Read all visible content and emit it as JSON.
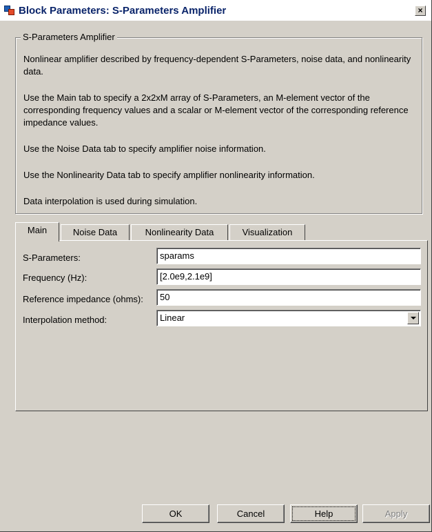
{
  "window": {
    "title": "Block Parameters: S-Parameters Amplifier",
    "close_symbol": "×"
  },
  "group": {
    "legend": "S-Parameters Amplifier",
    "paragraphs": [
      "Nonlinear amplifier described by frequency-dependent S-Parameters, noise data, and nonlinearity data.",
      "Use the Main tab to specify a 2x2xM array of S-Parameters, an M-element vector of the corresponding frequency values and a scalar or M-element vector of the corresponding reference impedance values.",
      "Use the Noise Data tab to specify amplifier noise information.",
      "Use the Nonlinearity Data tab to specify amplifier nonlinearity information.",
      "Data interpolation is used during simulation."
    ]
  },
  "tabs": [
    {
      "label": "Main",
      "active": true
    },
    {
      "label": "Noise Data",
      "active": false
    },
    {
      "label": "Nonlinearity Data",
      "active": false
    },
    {
      "label": "Visualization",
      "active": false
    }
  ],
  "main": {
    "s_parameters": {
      "label": "S-Parameters:",
      "value": "sparams"
    },
    "frequency": {
      "label": "Frequency (Hz):",
      "value": "[2.0e9,2.1e9]"
    },
    "reference_impedance": {
      "label": "Reference impedance (ohms):",
      "value": "50"
    },
    "interpolation_method": {
      "label": "Interpolation method:",
      "value": "Linear"
    }
  },
  "buttons": {
    "ok": "OK",
    "cancel": "Cancel",
    "help": "Help",
    "apply": "Apply"
  },
  "icons": {
    "app": "simulink-block-icon",
    "close": "close-icon",
    "dropdown": "chevron-down-icon"
  }
}
